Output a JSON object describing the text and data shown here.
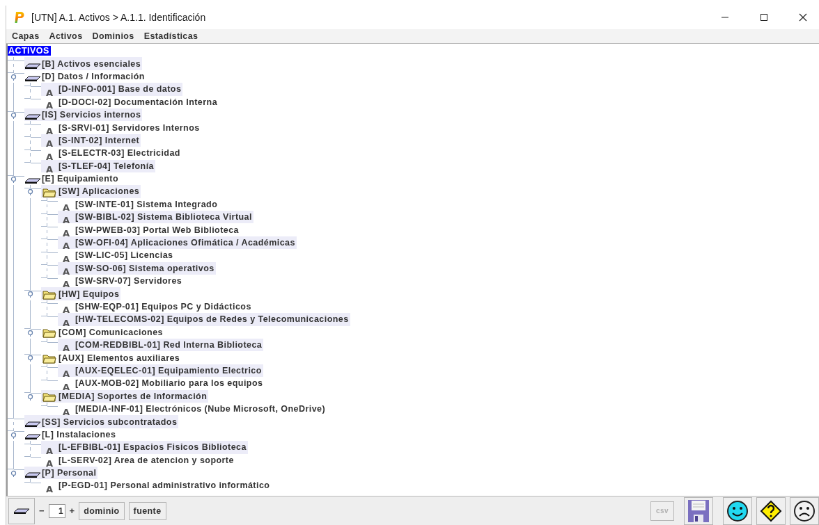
{
  "window": {
    "title": "[UTN] A.1. Activos > A.1.1. Identificación"
  },
  "menu": [
    "Capas",
    "Activos",
    "Dominios",
    "Estadísticas"
  ],
  "tree": {
    "label": "ACTIVOS",
    "selected": true,
    "children": [
      {
        "kind": "layer",
        "label": "[B] Activos esenciales",
        "selected": false
      },
      {
        "kind": "layer",
        "label": "[D] Datos / Información",
        "selected": false,
        "expanded": true,
        "children": [
          {
            "kind": "asset",
            "glyph": "A",
            "label": "[D-INFO-001] Base de datos",
            "selected": false
          },
          {
            "kind": "asset",
            "glyph": "A",
            "label": "[D-DOCI-02] Documentación Interna",
            "selected": false
          }
        ]
      },
      {
        "kind": "layer",
        "label": "[IS] Servicios internos",
        "selected": false,
        "expanded": true,
        "children": [
          {
            "kind": "asset",
            "glyph": "A",
            "label": "[S-SRVI-01] Servidores Internos",
            "selected": false
          },
          {
            "kind": "asset",
            "glyph": "A",
            "label": "[S-INT-02] Internet",
            "selected": false
          },
          {
            "kind": "asset",
            "glyph": "A",
            "label": "[S-ELECTR-03] Electricidad",
            "selected": false
          },
          {
            "kind": "asset",
            "glyph": "A",
            "label": "[S-TLEF-04] Telefonía",
            "selected": false
          }
        ]
      },
      {
        "kind": "layer",
        "label": "[E] Equipamiento",
        "selected": false,
        "expanded": true,
        "children": [
          {
            "kind": "group",
            "label": "[SW] Aplicaciones",
            "selected": false,
            "expanded": true,
            "children": [
              {
                "kind": "asset",
                "glyph": "A",
                "label": "[SW-INTE-01] Sistema Integrado",
                "selected": false
              },
              {
                "kind": "asset",
                "glyph": "A",
                "label": "[SW-BIBL-02] Sistema Biblioteca Virtual",
                "selected": false
              },
              {
                "kind": "asset",
                "glyph": "A",
                "label": "[SW-PWEB-03] Portal Web Biblioteca",
                "selected": false
              },
              {
                "kind": "asset",
                "glyph": "A",
                "label": "[SW-OFI-04] Aplicaciones Ofimática / Académicas",
                "selected": false
              },
              {
                "kind": "asset",
                "glyph": "A",
                "label": "[SW-LIC-05] Licencias",
                "selected": false
              },
              {
                "kind": "asset",
                "glyph": "A",
                "label": "[SW-SO-06] Sistema operativos",
                "selected": false
              },
              {
                "kind": "asset",
                "glyph": "A",
                "label": "[SW-SRV-07] Servidores",
                "selected": false
              }
            ]
          },
          {
            "kind": "group",
            "label": "[HW] Equipos",
            "selected": false,
            "expanded": true,
            "children": [
              {
                "kind": "asset",
                "glyph": "A",
                "label": "[SHW-EQP-01] Equipos PC y Didácticos",
                "selected": false
              },
              {
                "kind": "asset",
                "glyph": "A",
                "label": "[HW-TELECOMS-02] Equipos de Redes y Telecomunicaciones",
                "selected": false
              }
            ]
          },
          {
            "kind": "group",
            "label": "[COM] Comunicaciones",
            "selected": false,
            "expanded": true,
            "children": [
              {
                "kind": "asset",
                "glyph": "A",
                "label": "[COM-REDBIBL-01] Red Interna Biblioteca",
                "selected": false
              }
            ]
          },
          {
            "kind": "group",
            "label": "[AUX] Elementos auxiliares",
            "selected": false,
            "expanded": true,
            "children": [
              {
                "kind": "asset",
                "glyph": "A",
                "label": "[AUX-EQELEC-01] Equipamiento Electrico",
                "selected": false
              },
              {
                "kind": "asset",
                "glyph": "A",
                "label": "[AUX-MOB-02] Mobiliario para los equipos",
                "selected": false
              }
            ]
          },
          {
            "kind": "group",
            "label": "[MEDIA] Soportes de Información",
            "selected": false,
            "expanded": true,
            "children": [
              {
                "kind": "asset",
                "glyph": "A",
                "label": "[MEDIA-INF-01] Electrónicos (Nube Microsoft, OneDrive)",
                "selected": false
              }
            ]
          }
        ]
      },
      {
        "kind": "layer",
        "label": "[SS] Servicios subcontratados",
        "selected": false
      },
      {
        "kind": "layer",
        "label": "[L] Instalaciones",
        "selected": false,
        "expanded": true,
        "children": [
          {
            "kind": "asset",
            "glyph": "A",
            "label": "[L-EFBIBL-01] Espacios Fisicos Biblioteca",
            "selected": false
          },
          {
            "kind": "asset",
            "glyph": "A",
            "label": "[L-SERV-02] Area de atencion y soporte",
            "selected": false
          }
        ]
      },
      {
        "kind": "layer",
        "label": "[P] Personal",
        "selected": false,
        "expanded": true,
        "children": [
          {
            "kind": "asset",
            "glyph": "A",
            "label": "[P-EGD-01] Personal administrativo informático",
            "selected": false
          }
        ]
      }
    ]
  },
  "toolbar": {
    "minus": "−",
    "value": "1",
    "plus": "+",
    "buttons": [
      "dominio",
      "fuente"
    ],
    "csv": {
      "label": "csv",
      "disabled": true
    }
  }
}
